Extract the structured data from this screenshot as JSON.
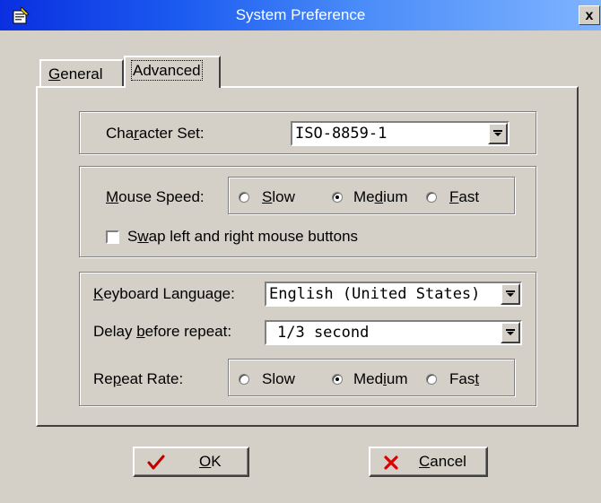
{
  "window": {
    "title": "System Preference",
    "close_label": "x"
  },
  "tabs": [
    {
      "label_prefix": "",
      "label_accel": "G",
      "label_rest": "eneral"
    },
    {
      "label_prefix": "",
      "label_accel": "",
      "label_rest": "Advanced"
    }
  ],
  "active_tab": "Advanced",
  "character_set": {
    "label_prefix": "Cha",
    "label_accel": "r",
    "label_rest": "acter Set:",
    "value": "ISO-8859-1"
  },
  "mouse": {
    "label_prefix": "",
    "label_accel": "M",
    "label_rest": "ouse Speed:",
    "options": [
      {
        "prefix": "",
        "accel": "S",
        "rest": "low",
        "checked": false
      },
      {
        "prefix": "Me",
        "accel": "d",
        "rest": "ium",
        "checked": true
      },
      {
        "prefix": "",
        "accel": "F",
        "rest": "ast",
        "checked": false
      }
    ],
    "swap": {
      "prefix": "S",
      "accel": "w",
      "rest": "ap left and right mouse buttons",
      "checked": false
    }
  },
  "keyboard": {
    "language": {
      "label_prefix": "",
      "label_accel": "K",
      "label_rest": "eyboard Language:",
      "value": "English (United States)"
    },
    "delay": {
      "label_prefix": "Delay ",
      "label_accel": "b",
      "label_rest": "efore repeat:",
      "value": "1/3 second"
    },
    "repeat_rate": {
      "label_prefix": "Re",
      "label_accel": "p",
      "label_rest": "eat Rate:",
      "options": [
        {
          "prefix": "",
          "accel": "",
          "rest": "Slow",
          "checked": false
        },
        {
          "prefix": "Med",
          "accel": "i",
          "rest": "um",
          "checked": true
        },
        {
          "prefix": "Fas",
          "accel": "t",
          "rest": "",
          "checked": false
        }
      ]
    }
  },
  "buttons": {
    "ok": {
      "accel": "O",
      "rest": "K",
      "icon": "checkmark-icon",
      "color": "#c00000"
    },
    "cancel": {
      "accel": "C",
      "rest": "ancel",
      "icon": "x-icon",
      "color": "#e00000"
    }
  }
}
